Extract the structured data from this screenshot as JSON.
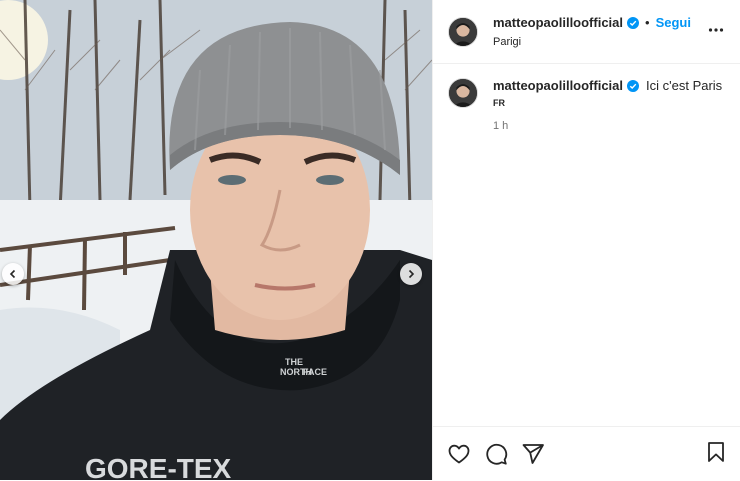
{
  "post": {
    "username": "matteopaolilloofficial",
    "location": "Parigi",
    "follow_label": "Segui",
    "separator": "•"
  },
  "caption": {
    "username": "matteopaolilloofficial",
    "text": "Ici c'est Paris",
    "language_tag": "FR",
    "time": "1 h"
  },
  "photo": {
    "jacket_text": "GORE-TEX",
    "logo_text": [
      "THE",
      "NORTH",
      "FACE"
    ]
  },
  "icons": {
    "verified": "verified-badge-icon",
    "more": "more-options-icon",
    "like": "heart-icon",
    "comment": "comment-icon",
    "share": "share-icon",
    "save": "bookmark-icon",
    "prev": "chevron-left-icon",
    "next": "chevron-right-icon"
  },
  "colors": {
    "accent": "#0095f6",
    "text": "#262626",
    "muted": "#737373"
  }
}
